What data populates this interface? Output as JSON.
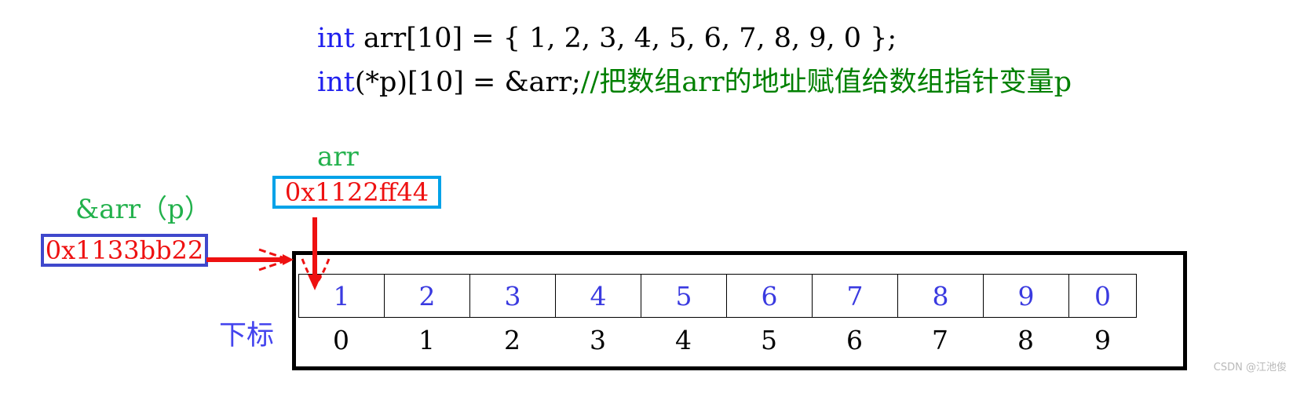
{
  "code": {
    "line1": {
      "keyword": "int",
      "rest": " arr[10] = { 1, 2, 3, 4, 5, 6, 7, 8, 9, 0 };"
    },
    "line2": {
      "keyword": "int",
      "rest": "(*p)[10] = &arr;",
      "comment": "//把数组arr的地址赋值给数组指针变量p"
    }
  },
  "labels": {
    "arr_label": "arr",
    "p_label": "&arr（p）",
    "index_label": "下标"
  },
  "addresses": {
    "arr_address": "0x1122ff44",
    "p_address": "0x1133bb22"
  },
  "array": {
    "values": [
      "1",
      "2",
      "3",
      "4",
      "5",
      "6",
      "7",
      "8",
      "9",
      "0"
    ],
    "indices": [
      "0",
      "1",
      "2",
      "3",
      "4",
      "5",
      "6",
      "7",
      "8",
      "9"
    ]
  },
  "colors": {
    "keyword": "#2020ee",
    "comment": "#008000",
    "green_label": "#22b14c",
    "address_text": "#ee1111",
    "arr_box_border": "#00a2e8",
    "p_box_border": "#3f48cc",
    "array_value": "#3a3ae0",
    "arrow": "#ee1111",
    "frame": "#000000"
  },
  "watermark": "CSDN @江池俊"
}
